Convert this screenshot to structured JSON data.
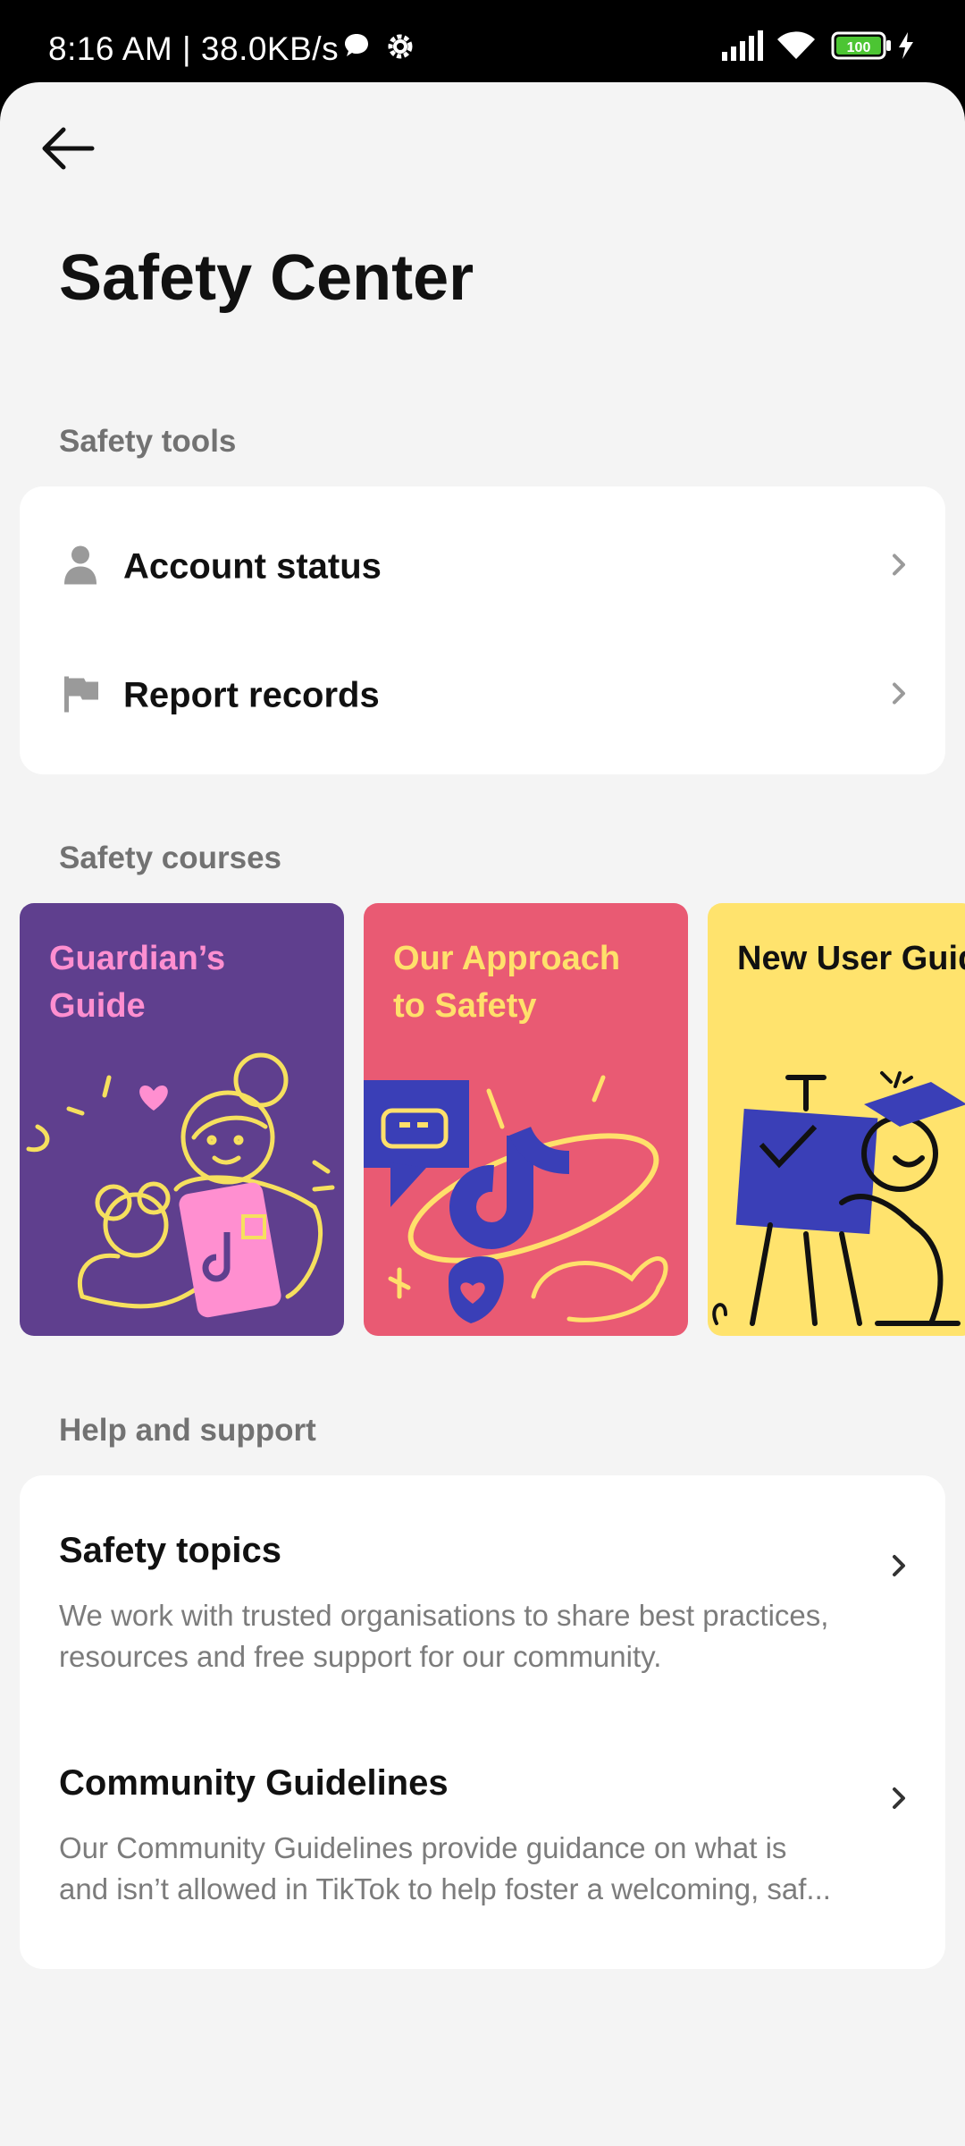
{
  "status_bar": {
    "time": "8:16 AM | 38.0KB/s",
    "battery": "100"
  },
  "header": {
    "title": "Safety Center"
  },
  "safety_tools": {
    "label": "Safety tools",
    "items": [
      {
        "label": "Account status",
        "icon": "person-icon"
      },
      {
        "label": "Report records",
        "icon": "flag-icon"
      }
    ]
  },
  "safety_courses": {
    "label": "Safety courses",
    "items": [
      {
        "title": "Guardian’s Guide",
        "bg": "#5f3f8e",
        "fg": "#ff8fd0"
      },
      {
        "title": "Our Approach to Safety",
        "bg": "#e95a73",
        "fg": "#ffe06b"
      },
      {
        "title": "New User Guide",
        "bg": "#ffe36d",
        "fg": "#111111"
      }
    ]
  },
  "help_support": {
    "label": "Help and support",
    "items": [
      {
        "title": "Safety topics",
        "desc_line1": "We work with trusted organisations to share best practices,",
        "desc_line2": "resources and free support for our community."
      },
      {
        "title": "Community Guidelines",
        "desc_line1": "Our Community Guidelines provide guidance on what is",
        "desc_line2": "and isn’t allowed in TikTok to help foster a welcoming, saf..."
      }
    ]
  },
  "colors": {
    "background": "#f4f4f4",
    "card": "#ffffff",
    "text_primary": "#111111",
    "text_secondary": "#7c7c7c"
  }
}
